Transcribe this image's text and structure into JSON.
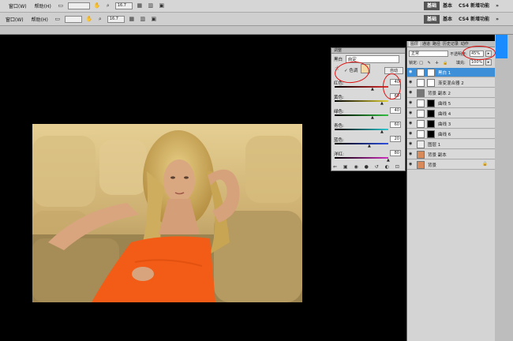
{
  "menu": {
    "window": "窗口(W)",
    "help": "帮助(H)",
    "zoom": "16.7"
  },
  "menu2": {
    "window": "窗口(W)",
    "help": "帮助(H)",
    "zoom": "16.7"
  },
  "workspace": {
    "design": "基础",
    "basic": "基本",
    "cs4": "CS4 新增功能",
    "arrows": "»"
  },
  "adjustments": {
    "tab": "调整",
    "preset_label": "黑白",
    "preset_value": "自定",
    "tint_label": "色调",
    "auto_label": "自动",
    "sliders": [
      {
        "label": "红色:",
        "value": "40"
      },
      {
        "label": "黄色:",
        "value": "60"
      },
      {
        "label": "绿色:",
        "value": "40"
      },
      {
        "label": "青色:",
        "value": "60"
      },
      {
        "label": "蓝色:",
        "value": "20"
      },
      {
        "label": "洋红:",
        "value": "80"
      }
    ]
  },
  "layers_panel": {
    "tabs": [
      "图层",
      "通道",
      "路径",
      "历史记录",
      "动作"
    ],
    "blend_mode": "正常",
    "opacity_label": "不透明度:",
    "opacity_value": "45%",
    "lock_label": "锁定:",
    "fill_label": "填充:",
    "fill_value": "100%",
    "layers": [
      {
        "name": "黑白 1"
      },
      {
        "name": "渐变混合器 2"
      },
      {
        "name": "背景 副本 2"
      },
      {
        "name": "曲线 5"
      },
      {
        "name": "曲线 4"
      },
      {
        "name": "曲线 3"
      },
      {
        "name": "曲线 6"
      },
      {
        "name": "图层 1"
      },
      {
        "name": "背景 副本"
      },
      {
        "name": "背景"
      }
    ]
  },
  "colors": {
    "selection": "#3d8fd8",
    "annotation": "#e01010",
    "collapse": "#1a8cff"
  }
}
